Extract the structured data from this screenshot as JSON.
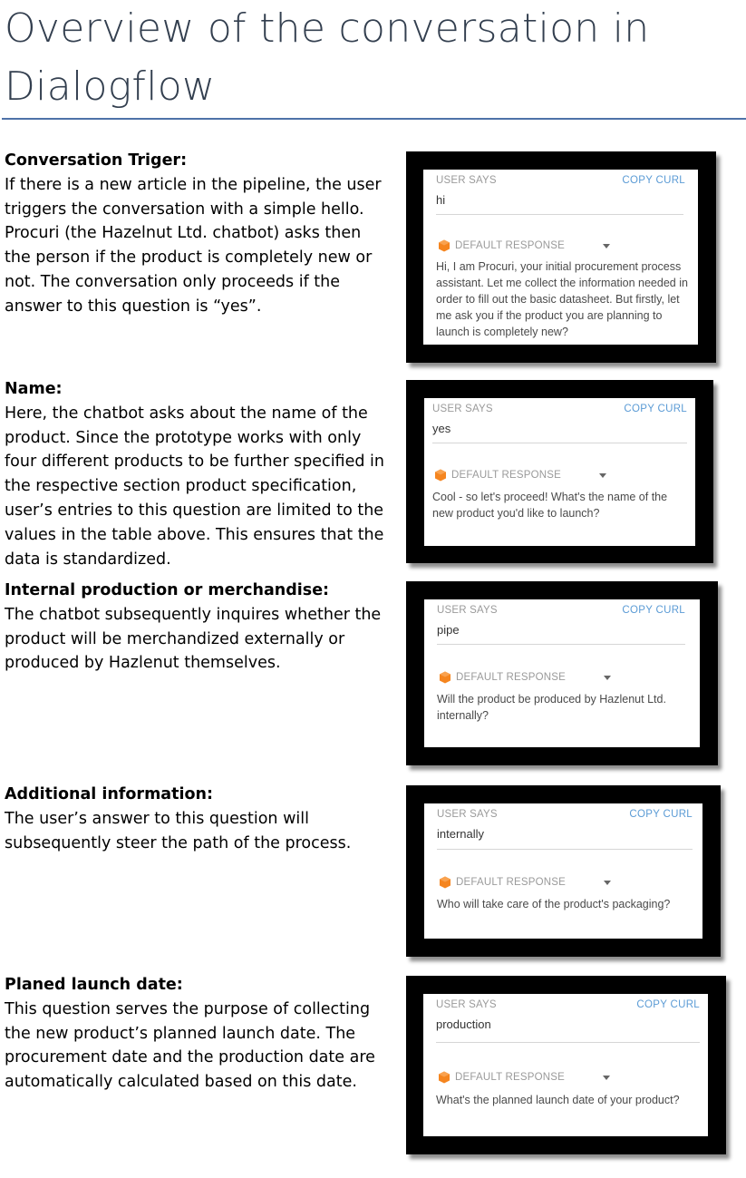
{
  "page": {
    "title": "Overview of the conversation in Dialogflow"
  },
  "sections": [
    {
      "heading": "Conversation Triger:",
      "body": "If there is a new article in the pipeline, the user triggers the conversation with a simple hello. Procuri (the Hazelnut Ltd. chatbot) asks then the person if the product is completely new or not. The conversation only proceeds if the answer to this question is “yes”."
    },
    {
      "heading": "Name:",
      "body": "Here, the chatbot asks about the name of the product. Since the prototype works with only four different products to be further specified in the respective section product specification, user’s entries to this question are limited to the values in the table above. This ensures that the data is standardized."
    },
    {
      "heading": "Internal production or merchandise:",
      "body": "The chatbot subsequently inquires whether the product will be merchandized externally or produced by Hazlenut themselves."
    },
    {
      "heading": "Additional information:",
      "body": "The user’s answer to this question will subsequently steer the path of the process."
    },
    {
      "heading": "Planed launch date:",
      "body": "This question serves the purpose of collecting the new product’s planned launch date. The procurement date and the production date are automatically calculated based on this date."
    }
  ],
  "cards": [
    {
      "user_says_label": "USER SAYS",
      "copy_curl_label": "COPY CURL",
      "user_value": "hi",
      "response_label": "DEFAULT RESPONSE",
      "response_text": "Hi, I am Procuri, your initial procurement process assistant. Let me collect the information needed in order to fill out the basic datasheet. But firstly, let me ask you if the product you are planning to launch is completely new?"
    },
    {
      "user_says_label": "USER SAYS",
      "copy_curl_label": "COPY CURL",
      "user_value": "yes",
      "response_label": "DEFAULT RESPONSE",
      "response_text": "Cool - so let's proceed! What's the name of the new product you'd like to launch?"
    },
    {
      "user_says_label": "USER SAYS",
      "copy_curl_label": "COPY CURL",
      "user_value": "pipe",
      "response_label": "DEFAULT RESPONSE",
      "response_text": "Will the product be produced by Hazlenut Ltd. internally?"
    },
    {
      "user_says_label": "USER SAYS",
      "copy_curl_label": "COPY CURL",
      "user_value": "internally",
      "response_label": "DEFAULT RESPONSE",
      "response_text": "Who will take care of the product's packaging?"
    },
    {
      "user_says_label": "USER SAYS",
      "copy_curl_label": "COPY CURL",
      "user_value": "production",
      "response_label": "DEFAULT RESPONSE",
      "response_text": "What's the planned launch date of your product?"
    }
  ],
  "icons": {
    "response_icon": "dialogflow-logo-icon",
    "dropdown_icon": "caret-down-icon"
  },
  "colors": {
    "title": "#333f4f",
    "title_rule": "#4f72a8",
    "copy_curl": "#5b9bd5",
    "dialogflow_orange": "#f5851f"
  }
}
